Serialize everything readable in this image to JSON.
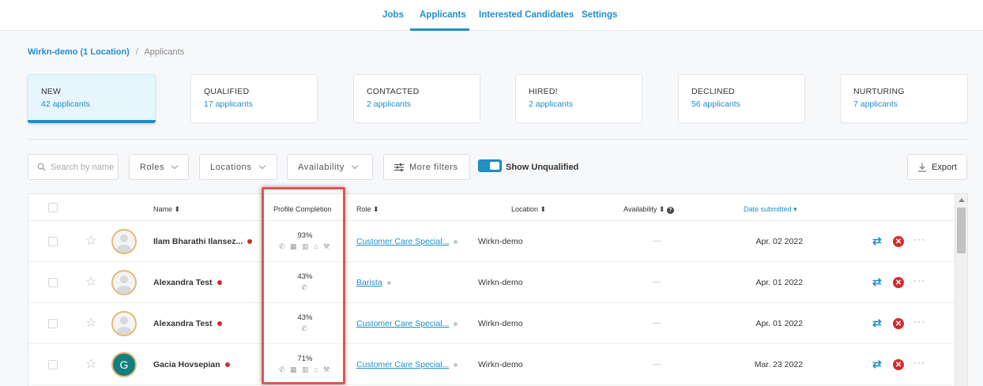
{
  "nav": {
    "tabs": [
      {
        "label": "Jobs"
      },
      {
        "label": "Applicants"
      },
      {
        "label": "Interested Candidates"
      },
      {
        "label": "Settings"
      }
    ],
    "active": "Applicants"
  },
  "breadcrumb": {
    "link": "Wirkn-demo (1 Location)",
    "separator": "/",
    "current": "Applicants"
  },
  "stages": [
    {
      "name": "NEW",
      "count": "42 applicants"
    },
    {
      "name": "QUALIFIED",
      "count": "17 applicants"
    },
    {
      "name": "CONTACTED",
      "count": "2 applicants"
    },
    {
      "name": "HIRED!",
      "count": "2 applicants"
    },
    {
      "name": "DECLINED",
      "count": "56 applicants"
    },
    {
      "name": "NURTURING",
      "count": "7 applicants"
    }
  ],
  "filters": {
    "search_placeholder": "Search by name",
    "roles": "Roles",
    "locations": "Locations",
    "availability": "Availability",
    "more_filters": "More filters",
    "show_unqualified": "Show Unqualified",
    "export": "Export"
  },
  "table": {
    "headers": {
      "name": "Name",
      "profile": "Profile Completion",
      "role": "Role",
      "location": "Location",
      "availability": "Availability",
      "date": "Date submitted"
    },
    "rows": [
      {
        "name": "Ilam Bharathi Ilansez...",
        "pct": "93%",
        "icons": "✆ ▦ ▥ ⌂ ⚒",
        "role": "Customer Care Special...",
        "location": "Wirkn-demo",
        "availability": "—",
        "date": "Apr. 02 2022",
        "avatar": "person"
      },
      {
        "name": "Alexandra Test",
        "pct": "43%",
        "icons": "✆",
        "role": "Barista",
        "location": "Wirkn-demo",
        "availability": "—",
        "date": "Apr. 01 2022",
        "avatar": "person"
      },
      {
        "name": "Alexandra Test",
        "pct": "43%",
        "icons": "✆",
        "role": "Customer Care Special...",
        "location": "Wirkn-demo",
        "availability": "—",
        "date": "Apr. 01 2022",
        "avatar": "person"
      },
      {
        "name": "Gacia Hovsepian",
        "pct": "71%",
        "icons": "✆ ▦ ▥ ⌂ ⚒",
        "role": "Customer Care Special...",
        "location": "Wirkn-demo",
        "availability": "—",
        "date": "Mar. 23 2022",
        "avatar": "G"
      }
    ]
  },
  "colors": {
    "accent": "#1f8fc9",
    "decline": "#d32b2b",
    "highlight": "#e2554f"
  }
}
